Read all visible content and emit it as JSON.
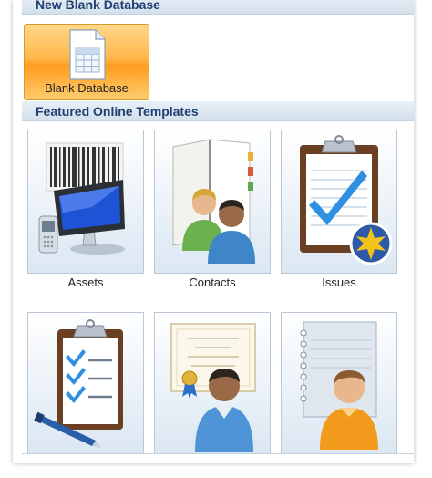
{
  "sections": {
    "blank": {
      "title": "New Blank Database"
    },
    "featured": {
      "title": "Featured Online Templates"
    }
  },
  "blank_database": {
    "label": "Blank Database",
    "icon": "blank-database-icon"
  },
  "templates": [
    {
      "label": "Assets",
      "icon": "assets-icon"
    },
    {
      "label": "Contacts",
      "icon": "contacts-icon"
    },
    {
      "label": "Issues",
      "icon": "issues-icon"
    },
    {
      "label": "",
      "icon": "checklist-clipboard-icon"
    },
    {
      "label": "",
      "icon": "certificate-person-icon"
    },
    {
      "label": "",
      "icon": "notebook-person-icon"
    }
  ],
  "colors": {
    "header_text": "#1f3f73",
    "selected_tile": "#ffb74a",
    "tile_border": "#b9c7d6"
  }
}
